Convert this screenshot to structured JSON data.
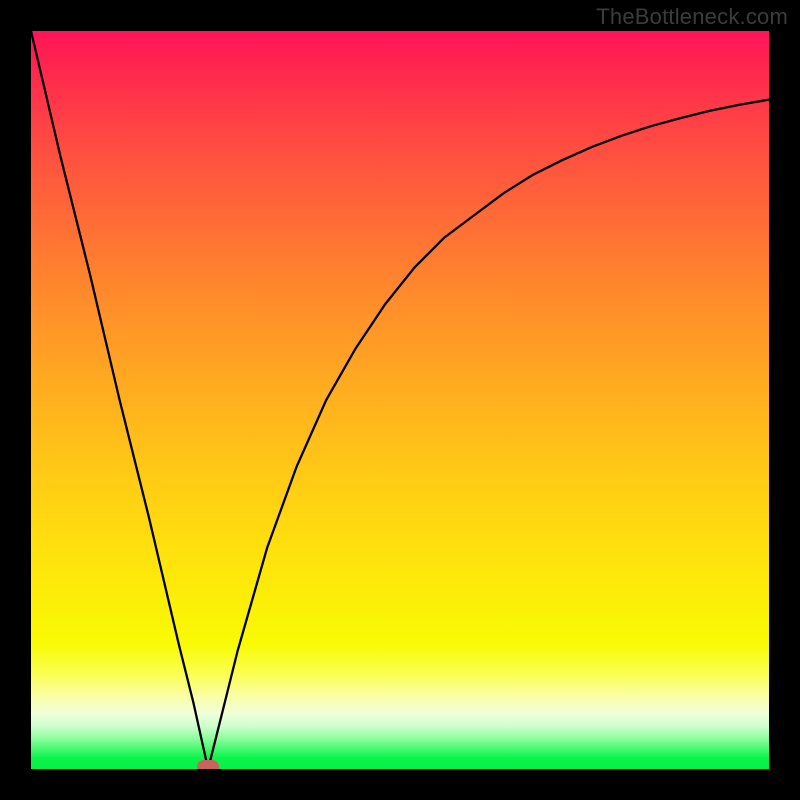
{
  "watermark": {
    "text": "TheBottleneck.com"
  },
  "colors": {
    "background": "#000000",
    "curve": "#000000",
    "bump": "#c9635d",
    "gradient_stops": [
      "#ff1459",
      "#ff4743",
      "#ff8b2b",
      "#ffc716",
      "#fbf206",
      "#ceffcf",
      "#04f145"
    ]
  },
  "chart_data": {
    "type": "line",
    "title": "",
    "xlabel": "",
    "ylabel": "",
    "xlim": [
      0,
      100
    ],
    "ylim": [
      0,
      100
    ],
    "annotations": [
      {
        "name": "optimal-point",
        "x": 24,
        "y": 0
      }
    ],
    "series": [
      {
        "name": "bottleneck-curve",
        "x": [
          0,
          4,
          8,
          12,
          16,
          20,
          22,
          24,
          26,
          28,
          32,
          36,
          40,
          44,
          48,
          52,
          56,
          60,
          64,
          68,
          72,
          76,
          80,
          84,
          88,
          92,
          96,
          100
        ],
        "values": [
          100,
          83,
          67,
          50,
          34,
          17,
          9,
          0,
          8,
          16,
          30,
          41,
          50,
          57,
          63,
          68,
          72,
          75,
          78,
          80.5,
          82.5,
          84.3,
          85.8,
          87.1,
          88.2,
          89.2,
          90,
          90.7
        ]
      }
    ]
  }
}
